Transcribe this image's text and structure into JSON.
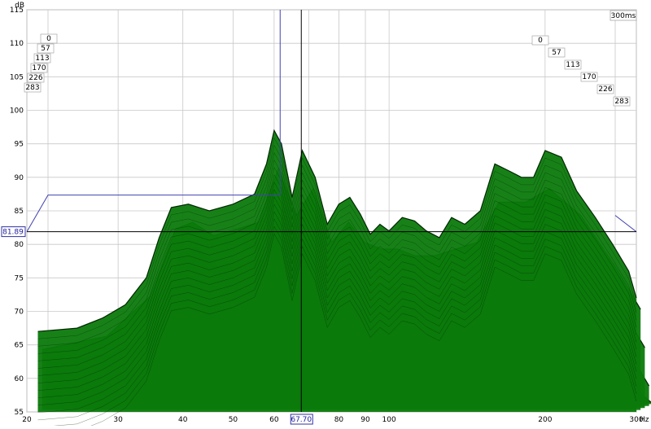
{
  "chart_data": {
    "type": "area",
    "xlabel": "",
    "ylabel": "",
    "x_unit": "Hz",
    "y_unit": "dB",
    "time_unit_label": "300ms",
    "x_scale": "log",
    "xlim": [
      20,
      300
    ],
    "ylim": [
      55,
      115
    ],
    "x_ticks": [
      20,
      30,
      40,
      50,
      60,
      70,
      80,
      90,
      100,
      200,
      300
    ],
    "x_tick_labels": [
      "20",
      "30",
      "40",
      "50",
      "60",
      "",
      "80",
      "90",
      "100",
      "200",
      "300"
    ],
    "y_ticks": [
      55,
      60,
      65,
      70,
      75,
      80,
      85,
      90,
      95,
      100,
      105,
      110,
      115
    ],
    "time_slices_ms": [
      "0",
      "57",
      "113",
      "170",
      "226",
      "283"
    ],
    "cursor": {
      "x_label": "67.70",
      "y_label": "81.89",
      "x": 67.7,
      "y": 81.89
    },
    "grid": true,
    "series": [
      {
        "time_ms": 0,
        "x": [
          21,
          25,
          28,
          31,
          34,
          36,
          38,
          41,
          45,
          50,
          55,
          58,
          60,
          62,
          65,
          68,
          72,
          76,
          80,
          84,
          88,
          92,
          96,
          100,
          106,
          112,
          118,
          125,
          132,
          140,
          150,
          160,
          170,
          180,
          190,
          200,
          215,
          230,
          250,
          270,
          290,
          300
        ],
        "y": [
          67,
          67.5,
          69,
          71,
          75,
          81,
          85.5,
          86,
          85,
          86,
          87.5,
          92,
          97,
          95,
          87,
          94,
          90,
          83,
          86,
          87,
          84.5,
          81.5,
          83,
          82,
          84,
          83.5,
          82,
          81,
          84,
          83,
          85,
          92,
          91,
          90,
          90,
          94,
          93,
          88,
          84,
          80,
          76,
          72
        ]
      },
      {
        "time_ms": 57,
        "x": [
          21,
          28,
          34,
          38,
          41,
          45,
          50,
          55,
          60,
          65,
          70,
          76,
          82,
          88,
          95,
          102,
          110,
          120,
          132,
          145,
          160,
          180,
          200,
          230,
          270,
          300
        ],
        "y": [
          64,
          66,
          72,
          82,
          83,
          81,
          82,
          83,
          91,
          84,
          88,
          80,
          83,
          80,
          79,
          79,
          78,
          78,
          79,
          80,
          86,
          86,
          88,
          84,
          76,
          70
        ]
      },
      {
        "time_ms": 113,
        "x": [
          21,
          28,
          34,
          38,
          41,
          45,
          50,
          55,
          60,
          65,
          70,
          76,
          82,
          88,
          95,
          102,
          110,
          120,
          132,
          145,
          160,
          180,
          200,
          230,
          270,
          300
        ],
        "y": [
          62,
          63,
          67,
          78,
          79,
          76,
          77,
          77,
          85,
          79,
          82,
          75,
          78,
          74,
          73,
          73,
          71,
          72,
          73,
          74,
          80,
          80,
          82,
          78,
          70,
          64
        ]
      },
      {
        "time_ms": 170,
        "x": [
          21,
          28,
          34,
          38,
          41,
          45,
          50,
          55,
          60,
          65,
          70,
          76,
          82,
          88,
          95,
          102,
          110,
          120,
          132,
          145,
          160,
          180,
          200,
          230,
          270,
          300
        ],
        "y": [
          60,
          61,
          63,
          73,
          74,
          70,
          71,
          71,
          79,
          73,
          76,
          69,
          72,
          68,
          67,
          67,
          64,
          66,
          66,
          68,
          74,
          73,
          76,
          72,
          64,
          58
        ]
      },
      {
        "time_ms": 226,
        "x": [
          21,
          28,
          34,
          38,
          41,
          45,
          50,
          55,
          60,
          65,
          70,
          76,
          82,
          88,
          95,
          102,
          110,
          120,
          132,
          145,
          160,
          180,
          200,
          230,
          270,
          300
        ],
        "y": [
          58,
          58,
          59,
          68,
          68,
          64,
          65,
          65,
          73,
          67,
          70,
          63,
          66,
          62,
          61,
          61,
          58,
          60,
          60,
          62,
          68,
          67,
          70,
          66,
          58,
          55
        ]
      },
      {
        "time_ms": 283,
        "x": [
          21,
          28,
          34,
          38,
          41,
          45,
          50,
          55,
          60,
          65,
          70,
          76,
          82,
          88,
          95,
          102,
          110,
          120,
          132,
          145,
          160,
          180,
          200,
          230,
          270,
          300
        ],
        "y": [
          56,
          56,
          56,
          63,
          62,
          58,
          59,
          59,
          67,
          61,
          64,
          57,
          60,
          56,
          55,
          55,
          55,
          55,
          55,
          56,
          62,
          61,
          64,
          60,
          55,
          55
        ]
      }
    ]
  },
  "colors": {
    "fill": "#0b7a0b",
    "line": "#032803",
    "grid": "#c8c8c8",
    "cursor": "#000000",
    "guide": "#4040b0"
  }
}
